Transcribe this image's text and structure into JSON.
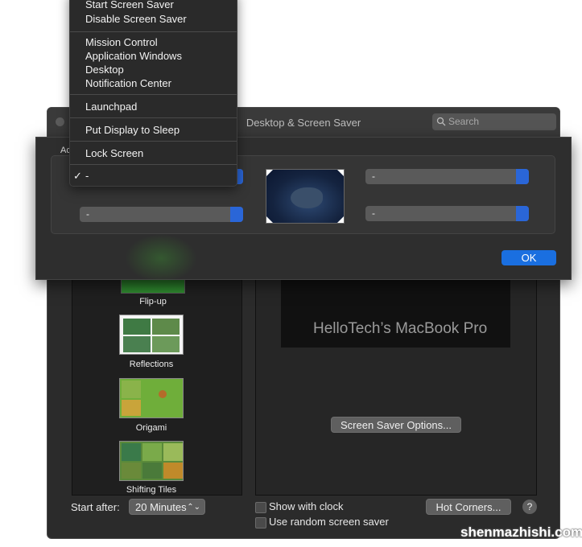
{
  "window": {
    "title": "Desktop & Screen Saver",
    "search_placeholder": "Search"
  },
  "screensavers": [
    {
      "label": "Flip-up"
    },
    {
      "label": "Reflections"
    },
    {
      "label": "Origami"
    },
    {
      "label": "Shifting Tiles"
    }
  ],
  "preview": {
    "text": "HelloTech’s MacBook Pro",
    "options_label": "Screen Saver Options..."
  },
  "bottom": {
    "start_after_label": "Start after:",
    "start_after_value": "20 Minutes",
    "show_clock_label": "Show with clock",
    "random_label": "Use random screen saver",
    "hot_corners_label": "Hot Corners...",
    "help_label": "?"
  },
  "hot_corners": {
    "peek_label": "Ac",
    "top_left": "-",
    "bottom_left": "-",
    "top_right": "-",
    "bottom_right": "-",
    "ok_label": "OK"
  },
  "menu": {
    "items": [
      "Start Screen Saver",
      "Disable Screen Saver",
      "Mission Control",
      "Application Windows",
      "Desktop",
      "Notification Center",
      "Launchpad",
      "Put Display to Sleep",
      "Lock Screen",
      "-"
    ],
    "checkmark": "✓"
  },
  "watermark": "shenmazhishi.com",
  "colors": {
    "accent": "#1a6fe0",
    "window_bg": "#2b2b2b",
    "menu_bg": "#2a2a2a"
  }
}
